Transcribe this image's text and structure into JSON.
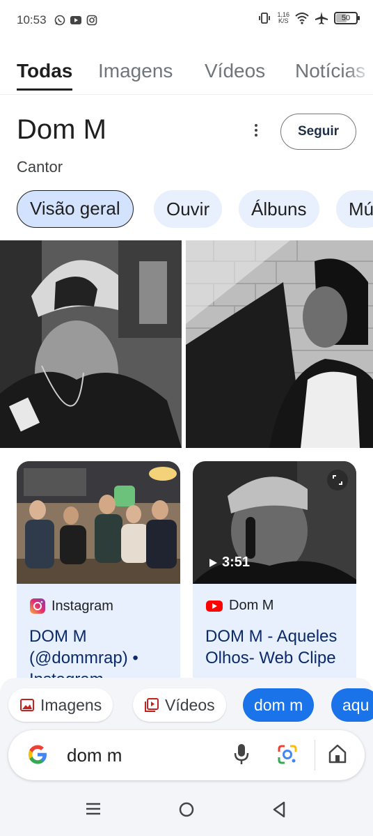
{
  "status_bar": {
    "time": "10:53",
    "app_icons": [
      "whatsapp-icon",
      "youtube-icon",
      "instagram-icon"
    ],
    "net_speed_value": "1,16",
    "net_speed_unit": "K/S",
    "battery_level": "50"
  },
  "search_tabs": [
    {
      "label": "Todas",
      "active": true
    },
    {
      "label": "Imagens",
      "active": false
    },
    {
      "label": "Vídeos",
      "active": false
    },
    {
      "label": "Notícias",
      "active": false
    }
  ],
  "entity": {
    "title": "Dom M",
    "subtitle": "Cantor",
    "follow_label": "Seguir"
  },
  "chips": [
    {
      "label": "Visão geral",
      "active": true
    },
    {
      "label": "Ouvir",
      "active": false
    },
    {
      "label": "Álbuns",
      "active": false
    },
    {
      "label": "Mú",
      "active": false
    }
  ],
  "cards": [
    {
      "source": "Instagram",
      "source_icon": "instagram-icon",
      "title": "DOM M (@dommrap) • Instagram"
    },
    {
      "source": "Dom M",
      "source_icon": "youtube-icon",
      "title": "DOM M - Aqueles Olhos- Web Clipe",
      "duration": "3:51"
    }
  ],
  "suggestions": [
    {
      "label": "Imagens",
      "icon": "image-icon",
      "style": "plain"
    },
    {
      "label": "Vídeos",
      "icon": "video-icon",
      "style": "plain"
    },
    {
      "label": "dom m",
      "style": "blue"
    },
    {
      "label": "aqu",
      "style": "blue"
    }
  ],
  "search": {
    "query": "dom m"
  },
  "colors": {
    "accent_blue": "#1a73e8",
    "chip_bg": "#e8f0fe",
    "card_title": "#0b2a6b"
  }
}
